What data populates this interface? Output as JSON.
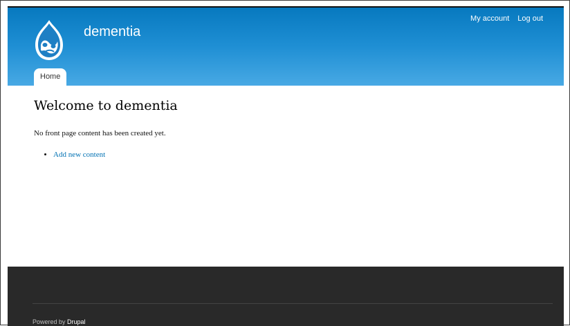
{
  "site": {
    "name": "dementia",
    "logo": "drupal-drop-icon"
  },
  "secondary_menu": {
    "my_account": "My account",
    "log_out": "Log out"
  },
  "main_menu": {
    "home": "Home"
  },
  "main": {
    "title": "Welcome to dementia",
    "intro": "No front page content has been created yet.",
    "links": [
      "Add new content"
    ]
  },
  "footer": {
    "powered_by": "Powered by",
    "drupal": "Drupal"
  },
  "colors": {
    "header_top": "#0779bf",
    "header_bottom": "#48a9e4",
    "footer_bg": "#292929",
    "link": "#0071b3"
  }
}
